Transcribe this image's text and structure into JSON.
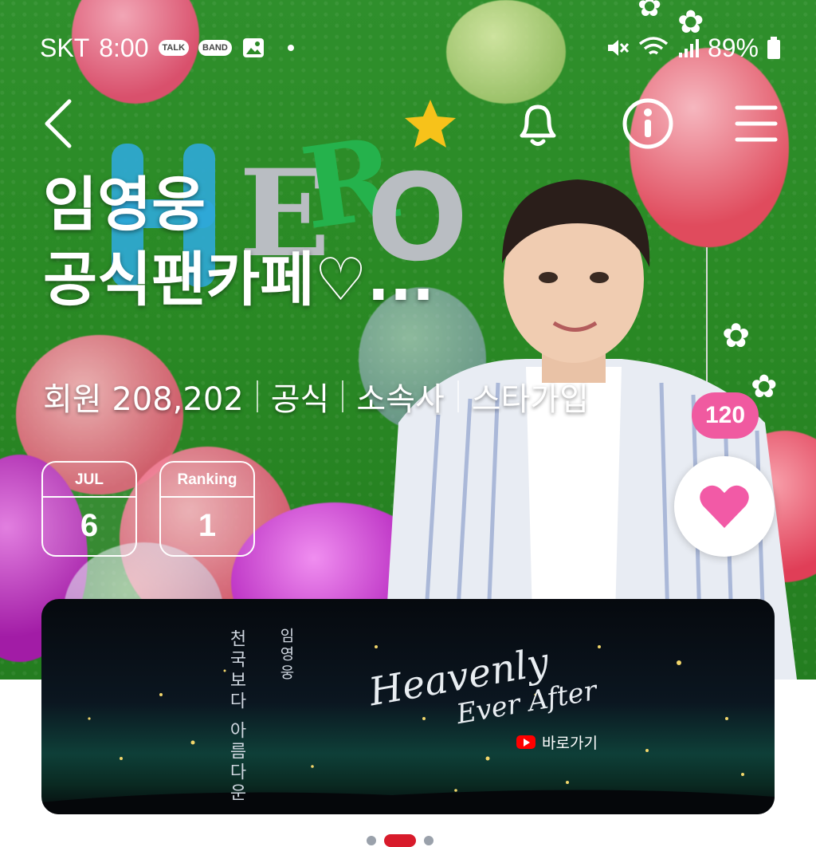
{
  "status_bar": {
    "carrier": "SKT",
    "time": "8:00",
    "talk_badge": "TALK",
    "band_badge": "BAND",
    "battery": "89%"
  },
  "header": {
    "title_line1": "임영웅",
    "title_line2": "공식팬카페♡...",
    "members_label": "회원 208,202",
    "tags": [
      "공식",
      "소속사",
      "스타가입"
    ]
  },
  "cards": {
    "date": {
      "label": "JUL",
      "value": "6"
    },
    "ranking": {
      "label": "Ranking",
      "value": "1"
    }
  },
  "likes": {
    "count": "120"
  },
  "banner": {
    "vertical_text_1": "천국보다 아름다운",
    "vertical_text_2": "임영웅",
    "script_title_1": "Heavenly",
    "script_title_2": "Ever After",
    "link_label": "바로가기"
  },
  "colors": {
    "accent_pink": "#f05aa0",
    "heart_pink": "#f25aa6",
    "star_yellow": "#f7c21a",
    "youtube_red": "#ff0000"
  }
}
